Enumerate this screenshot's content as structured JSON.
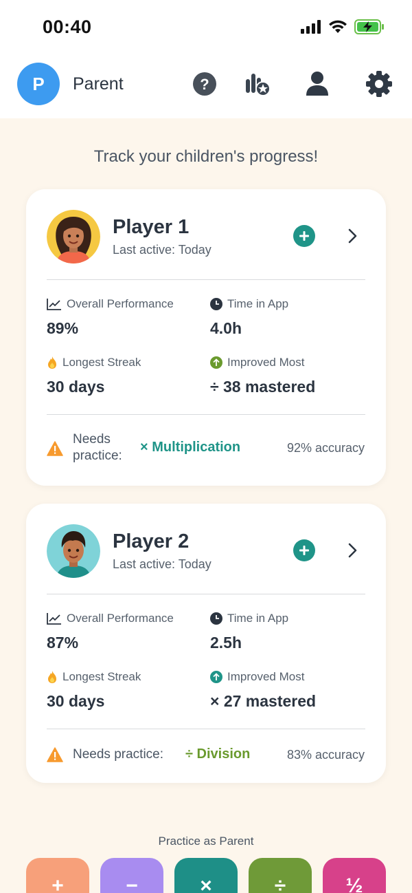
{
  "status": {
    "time": "00:40"
  },
  "header": {
    "avatar_letter": "P",
    "user_name": "Parent",
    "icons": [
      "help-icon",
      "leaderboard-icon",
      "profile-icon",
      "settings-icon"
    ]
  },
  "subtitle": "Track your children's progress!",
  "players": [
    {
      "name": "Player 1",
      "last_active": "Last active: Today",
      "stats": {
        "performance_label": "Overall Performance",
        "performance_value": "89%",
        "time_label": "Time in App",
        "time_value": "4.0h",
        "streak_label": "Longest Streak",
        "streak_value": "30 days",
        "improved_label": "Improved Most",
        "improved_value": "÷ 38 mastered"
      },
      "needs_label_line1": "Needs",
      "needs_label_line2": "practice:",
      "needs_skill": "× Multiplication",
      "accuracy": "92% accuracy"
    },
    {
      "name": "Player 2",
      "last_active": "Last active: Today",
      "stats": {
        "performance_label": "Overall Performance",
        "performance_value": "87%",
        "time_label": "Time in App",
        "time_value": "2.5h",
        "streak_label": "Longest Streak",
        "streak_value": "30 days",
        "improved_label": "Improved Most",
        "improved_value": "× 27 mastered"
      },
      "needs_label": "Needs practice:",
      "needs_skill": "÷ Division",
      "accuracy": "83% accuracy"
    }
  ],
  "practice": {
    "label": "Practice as Parent",
    "ops": [
      "+",
      "−",
      "×",
      "÷",
      "½"
    ]
  },
  "colors": {
    "background": "#fdf6ec",
    "accent_teal": "#1f9488",
    "accent_green": "#6a9a2e",
    "avatar_blue": "#3d9bf0",
    "op_add": "#f7a07a",
    "op_sub": "#a88cf0",
    "op_mul": "#1e8f87",
    "op_div": "#6f9a38",
    "op_frac": "#d7418a"
  }
}
